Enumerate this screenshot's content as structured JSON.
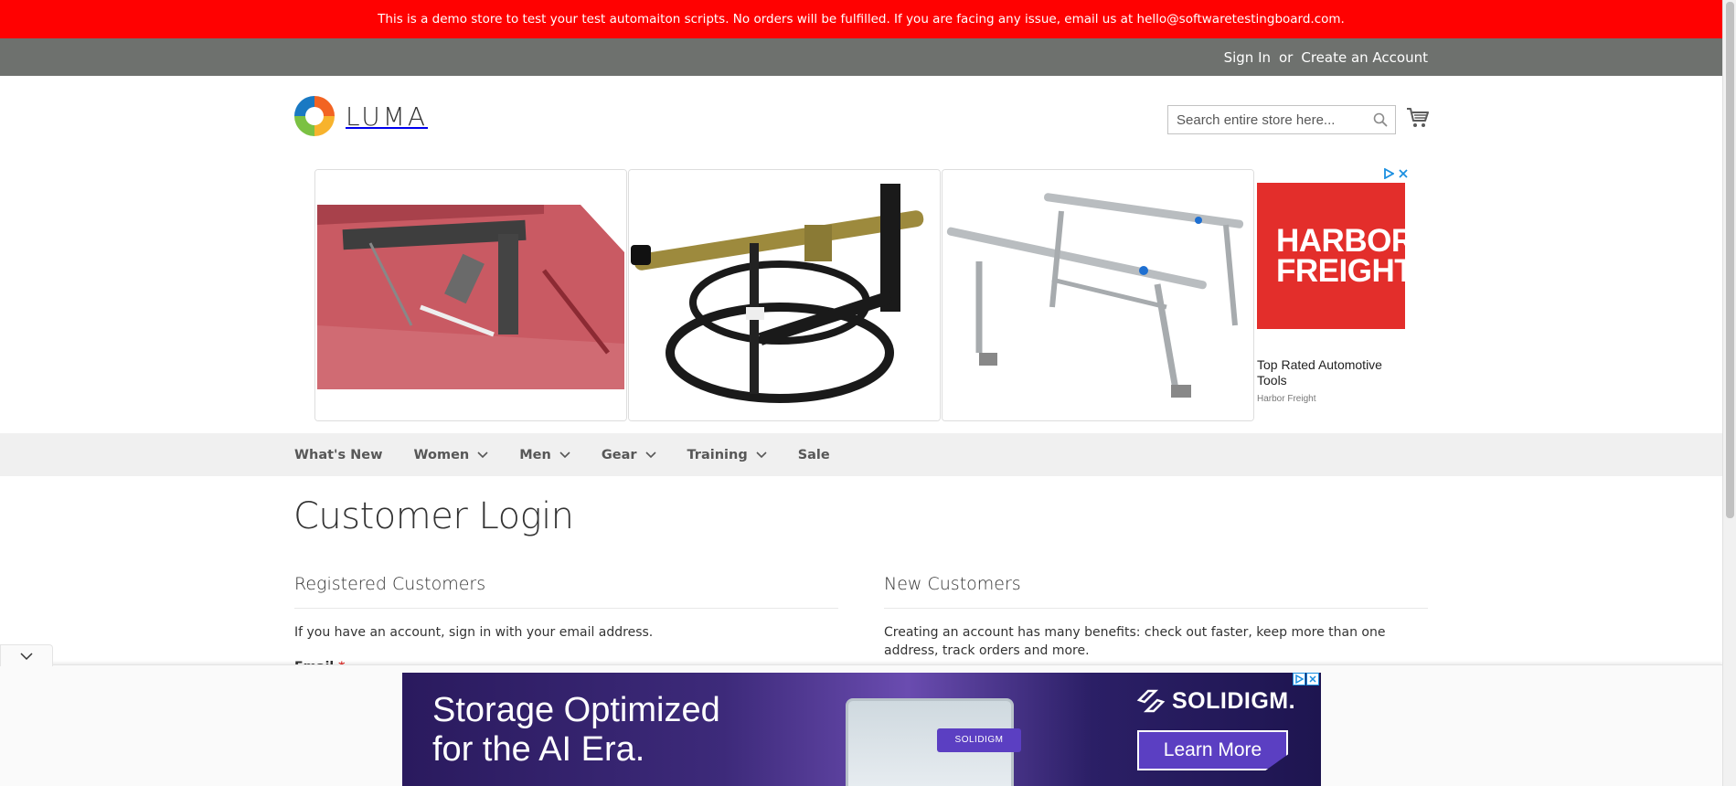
{
  "notice": {
    "text": "This is a demo store to test your test automaiton scripts. No orders will be fulfilled. If you are facing any issue, email us at hello@softwaretestingboard.com."
  },
  "top_links": {
    "sign_in": "Sign In",
    "separator": "or",
    "create_account": "Create an Account"
  },
  "header": {
    "logo_text": "LUMA",
    "search_placeholder": "Search entire store here...",
    "icons": {
      "search": "search-icon",
      "cart": "cart-icon"
    }
  },
  "ad_top": {
    "brand_logo": "HARBOR FREIGHT",
    "title": "Top Rated Automotive Tools",
    "brand": "Harbor Freight"
  },
  "nav": {
    "items": [
      {
        "label": "What's New",
        "has_dropdown": false
      },
      {
        "label": "Women",
        "has_dropdown": true
      },
      {
        "label": "Men",
        "has_dropdown": true
      },
      {
        "label": "Gear",
        "has_dropdown": true
      },
      {
        "label": "Training",
        "has_dropdown": true
      },
      {
        "label": "Sale",
        "has_dropdown": false
      }
    ]
  },
  "main": {
    "title": "Customer Login",
    "registered": {
      "title": "Registered Customers",
      "text": "If you have an account, sign in with your email address.",
      "email_label": "Email",
      "required_mark": "*"
    },
    "new_customers": {
      "title": "New Customers",
      "text": "Creating an account has many benefits: check out faster, keep more than one address, track orders and more."
    }
  },
  "bottom_ad": {
    "headline_line1": "Storage Optimized",
    "headline_line2": "for the AI Era.",
    "device_tag": "SOLIDIGM",
    "brand": "SOLIDIGM.",
    "cta": "Learn More"
  },
  "colors": {
    "notice_bg": "#ff0101",
    "top_panel_bg": "#6e716e",
    "nav_bg": "#f0f0f0",
    "harbor_freight_red": "#e32e2b",
    "solidigm_purple": "#5b3fc2"
  }
}
